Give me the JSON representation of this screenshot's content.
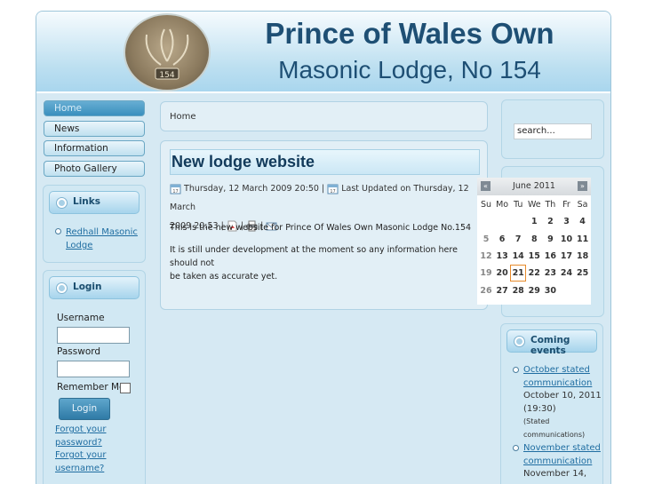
{
  "header": {
    "title_line1": "Prince of Wales Own",
    "title_line2": "Masonic Lodge, No 154",
    "logo_text": "154"
  },
  "nav": [
    {
      "label": "Home",
      "active": true
    },
    {
      "label": "News",
      "active": false
    },
    {
      "label": "Information",
      "active": false
    },
    {
      "label": "Photo Gallery",
      "active": false
    }
  ],
  "links_box": {
    "heading": "Links",
    "items": [
      "Redhall Masonic",
      "Lodge"
    ]
  },
  "login_box": {
    "heading": "Login",
    "username_label": "Username",
    "password_label": "Password",
    "remember_label": "Remember Me",
    "login_button": "Login",
    "forgot_password": [
      "Forgot your",
      "password?"
    ],
    "forgot_username": [
      "Forgot your",
      "username?"
    ]
  },
  "breadcrumb": "Home",
  "article": {
    "title": "New lodge website",
    "created": "Thursday, 12 March 2009 20:50",
    "updated_prefix": "Last Updated on Thursday, 12 March",
    "updated_time": "2009 20:53",
    "sep": "|",
    "paragraph1": "This is the new website for Prince Of Wales Own Masonic Lodge No.154",
    "paragraph2_line1": "It is still under development at the moment so any information here should not",
    "paragraph2_line2": "be taken as accurate yet."
  },
  "search": {
    "value": "search..."
  },
  "calendar": {
    "month": "June 2011",
    "prev": "«",
    "next": "»",
    "weekdays": [
      "Su",
      "Mo",
      "Tu",
      "We",
      "Th",
      "Fr",
      "Sa"
    ],
    "weeks": [
      [
        "",
        "",
        "",
        "1",
        "2",
        "3",
        "4"
      ],
      [
        "5",
        "6",
        "7",
        "8",
        "9",
        "10",
        "11"
      ],
      [
        "12",
        "13",
        "14",
        "15",
        "16",
        "17",
        "18"
      ],
      [
        "19",
        "20",
        "21",
        "22",
        "23",
        "24",
        "25"
      ],
      [
        "26",
        "27",
        "28",
        "29",
        "30",
        "",
        ""
      ]
    ],
    "today": "21"
  },
  "events": {
    "heading": "Coming events",
    "items": [
      {
        "title": [
          "October stated",
          "communication"
        ],
        "date": [
          "October 10, 2011",
          "(19:30)"
        ],
        "category": [
          "(Stated",
          "communications)"
        ]
      },
      {
        "title": [
          "November stated",
          "communication"
        ],
        "date": [
          "November 14,"
        ]
      }
    ]
  },
  "colors": {
    "accent": "#1e4f74",
    "link": "#1f6da1",
    "panel": "#d1e8f3"
  }
}
